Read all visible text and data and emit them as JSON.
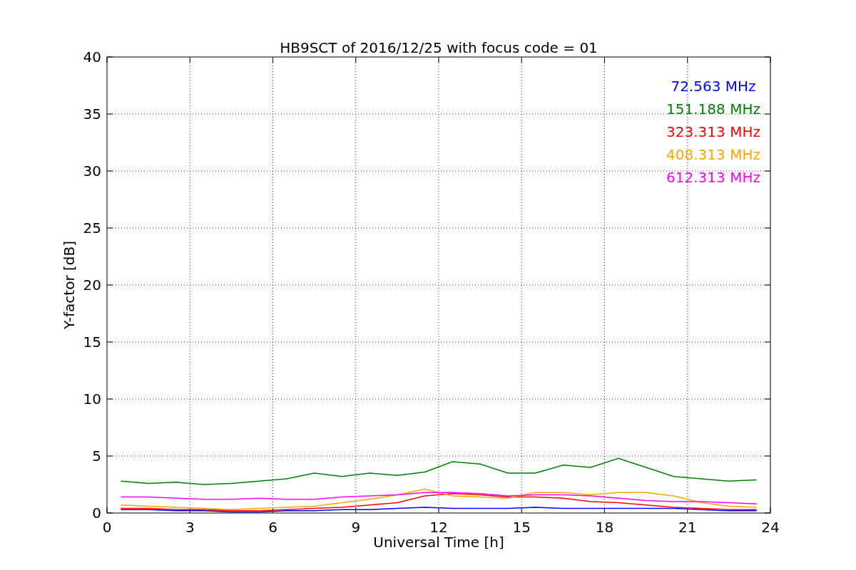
{
  "figure": {
    "chart_data": {
      "type": "line",
      "title": "HB9SCT of 2016/12/25 with focus code = 01",
      "xlabel": "Universal Time [h]",
      "ylabel": "Y-factor [dB]",
      "x": [
        0.5,
        1.5,
        2.5,
        3.5,
        4.5,
        5.5,
        6.5,
        7.5,
        8.5,
        9.5,
        10.5,
        11.5,
        12.5,
        13.5,
        14.5,
        15.5,
        16.5,
        17.5,
        18.5,
        19.5,
        20.5,
        21.5,
        22.5,
        23.5
      ],
      "series": [
        {
          "name": "72.563 MHz",
          "color": "#0000ff",
          "values": [
            0.3,
            0.3,
            0.2,
            0.2,
            0.1,
            0.1,
            0.2,
            0.2,
            0.3,
            0.3,
            0.4,
            0.5,
            0.4,
            0.4,
            0.4,
            0.5,
            0.4,
            0.4,
            0.4,
            0.4,
            0.4,
            0.3,
            0.2,
            0.2
          ]
        },
        {
          "name": "151.188 MHz",
          "color": "#008000",
          "values": [
            2.8,
            2.6,
            2.7,
            2.5,
            2.6,
            2.8,
            3.0,
            3.5,
            3.2,
            3.5,
            3.3,
            3.6,
            4.5,
            4.3,
            3.5,
            3.5,
            4.2,
            4.0,
            4.8,
            4.0,
            3.2,
            3.0,
            2.8,
            2.9
          ]
        },
        {
          "name": "323.313 MHz",
          "color": "#ff0000",
          "values": [
            0.4,
            0.4,
            0.3,
            0.3,
            0.2,
            0.2,
            0.3,
            0.4,
            0.5,
            0.7,
            0.9,
            1.5,
            1.7,
            1.6,
            1.4,
            1.4,
            1.3,
            1.0,
            0.9,
            0.7,
            0.5,
            0.4,
            0.3,
            0.3
          ]
        },
        {
          "name": "408.313 MHz",
          "color": "#ffa500",
          "values": [
            0.7,
            0.6,
            0.5,
            0.4,
            0.3,
            0.4,
            0.5,
            0.6,
            0.9,
            1.2,
            1.6,
            2.1,
            1.5,
            1.4,
            1.3,
            1.8,
            1.8,
            1.6,
            1.8,
            1.8,
            1.5,
            0.9,
            0.6,
            0.5
          ]
        },
        {
          "name": "612.313 MHz",
          "color": "#ff00ff",
          "values": [
            1.4,
            1.4,
            1.3,
            1.2,
            1.2,
            1.3,
            1.2,
            1.2,
            1.4,
            1.5,
            1.6,
            1.8,
            1.8,
            1.7,
            1.5,
            1.6,
            1.6,
            1.5,
            1.3,
            1.1,
            1.0,
            1.0,
            0.9,
            0.8
          ]
        }
      ],
      "grid": true,
      "xlim": [
        0,
        24
      ],
      "ylim": [
        0,
        40
      ],
      "xticks": [
        0,
        3,
        6,
        9,
        12,
        15,
        18,
        21,
        24
      ],
      "yticks": [
        0,
        5,
        10,
        15,
        20,
        25,
        30,
        35,
        40
      ]
    }
  }
}
